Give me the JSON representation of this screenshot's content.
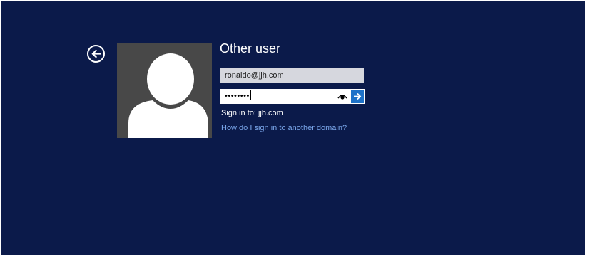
{
  "login": {
    "title": "Other user",
    "username_value": "ronaldo@jjh.com",
    "password_masked": "••••••••",
    "sign_in_to": "Sign in to: jjh.com",
    "help_link": "How do I sign in to another domain?"
  },
  "icons": {
    "back": "back-arrow-icon",
    "avatar": "user-silhouette-icon",
    "reveal": "eye-icon",
    "submit": "arrow-right-icon"
  },
  "colors": {
    "background": "#0b1a4a",
    "accent": "#1e72c8",
    "link": "#7aa6ea",
    "avatar_bg": "#484848",
    "username_field_bg": "#d6d7de"
  }
}
